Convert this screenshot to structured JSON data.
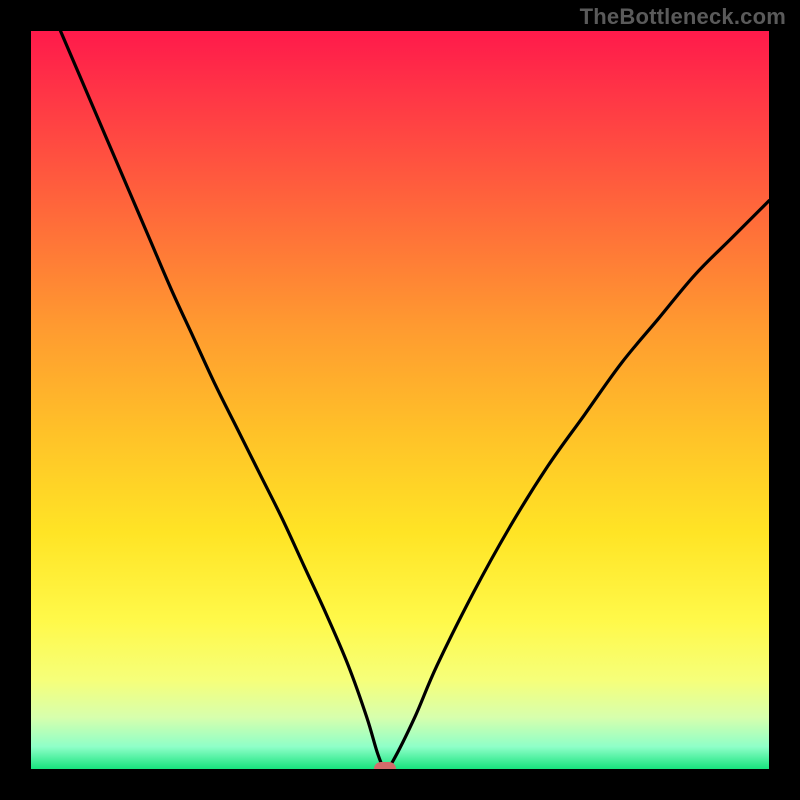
{
  "watermark": "TheBottleneck.com",
  "chart_data": {
    "type": "line",
    "title": "",
    "xlabel": "",
    "ylabel": "",
    "xlim": [
      0,
      100
    ],
    "ylim": [
      0,
      100
    ],
    "grid": false,
    "series": [
      {
        "name": "bottleneck-curve",
        "x": [
          4,
          7,
          10,
          13,
          16,
          19,
          22,
          25,
          28,
          31,
          34,
          37,
          40,
          43,
          45.5,
          47,
          48,
          49,
          52,
          55,
          60,
          65,
          70,
          75,
          80,
          85,
          90,
          95,
          100
        ],
        "values": [
          100,
          93,
          86,
          79,
          72,
          65,
          58.5,
          52,
          46,
          40,
          34,
          27.5,
          21,
          14,
          7,
          2,
          0,
          1,
          7,
          14,
          24,
          33,
          41,
          48,
          55,
          61,
          67,
          72,
          77
        ]
      }
    ],
    "optimal_point": {
      "x": 48,
      "y": 0
    },
    "gradient_stops": [
      {
        "pos": 0,
        "color": "#ff1a4b"
      },
      {
        "pos": 10,
        "color": "#ff3a45"
      },
      {
        "pos": 25,
        "color": "#ff6a3a"
      },
      {
        "pos": 40,
        "color": "#ff9a30"
      },
      {
        "pos": 55,
        "color": "#ffc328"
      },
      {
        "pos": 68,
        "color": "#ffe425"
      },
      {
        "pos": 80,
        "color": "#fff94a"
      },
      {
        "pos": 88,
        "color": "#f6ff7a"
      },
      {
        "pos": 93,
        "color": "#d7ffad"
      },
      {
        "pos": 97,
        "color": "#8effc8"
      },
      {
        "pos": 100,
        "color": "#17e37d"
      }
    ],
    "marker_color": "#d46b6b",
    "curve_color": "#000000"
  }
}
